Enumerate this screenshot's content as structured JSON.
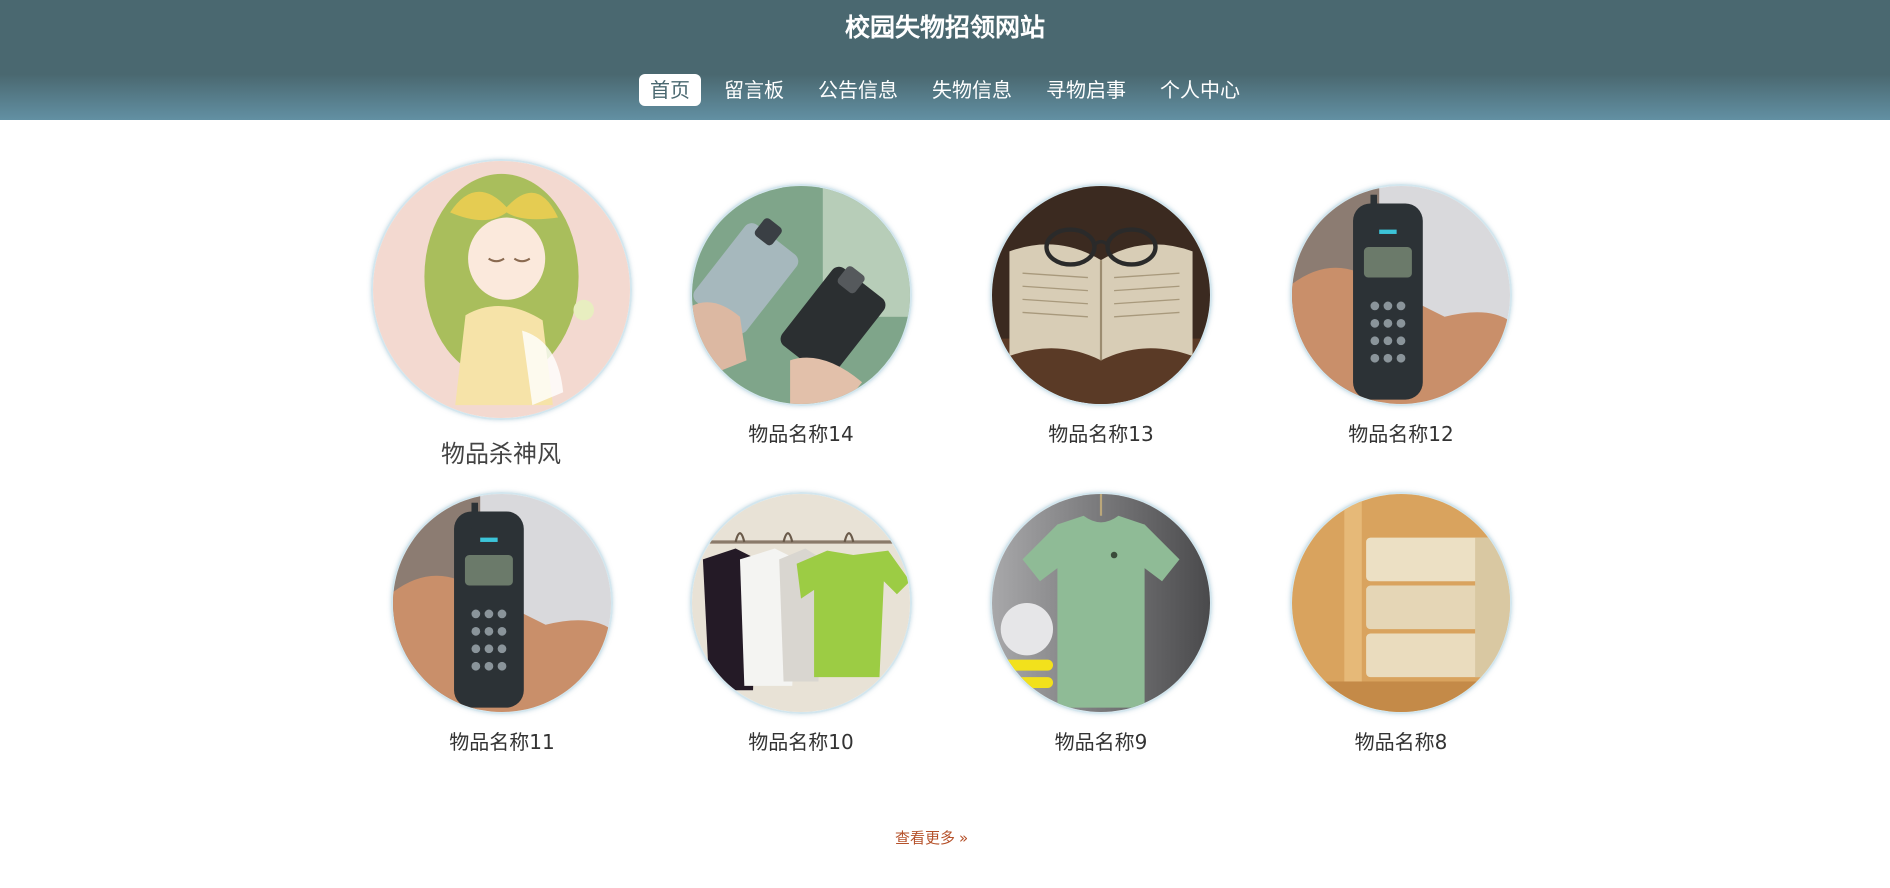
{
  "header": {
    "title": "校园失物招领网站",
    "nav": [
      {
        "label": "首页",
        "active": true
      },
      {
        "label": "留言板",
        "active": false
      },
      {
        "label": "公告信息",
        "active": false
      },
      {
        "label": "失物信息",
        "active": false
      },
      {
        "label": "寻物启事",
        "active": false
      },
      {
        "label": "个人中心",
        "active": false
      }
    ]
  },
  "items": [
    {
      "name": "物品杀神风",
      "image": "anime-girl-illustration"
    },
    {
      "name": "物品名称14",
      "image": "two-smartphones"
    },
    {
      "name": "物品名称13",
      "image": "glasses-on-book"
    },
    {
      "name": "物品名称12",
      "image": "cellphone-in-hand"
    },
    {
      "name": "物品名称11",
      "image": "cellphone-in-hand"
    },
    {
      "name": "物品名称10",
      "image": "t-shirts-on-hangers"
    },
    {
      "name": "物品名称9",
      "image": "green-t-shirt"
    },
    {
      "name": "物品名称8",
      "image": "stack-of-books"
    }
  ],
  "more": {
    "label": "查看更多",
    "icon": "double-chevron-right-icon"
  },
  "colors": {
    "header_top": "#4a6870",
    "header_bottom": "#6290a3",
    "more_link": "#b5512a"
  }
}
